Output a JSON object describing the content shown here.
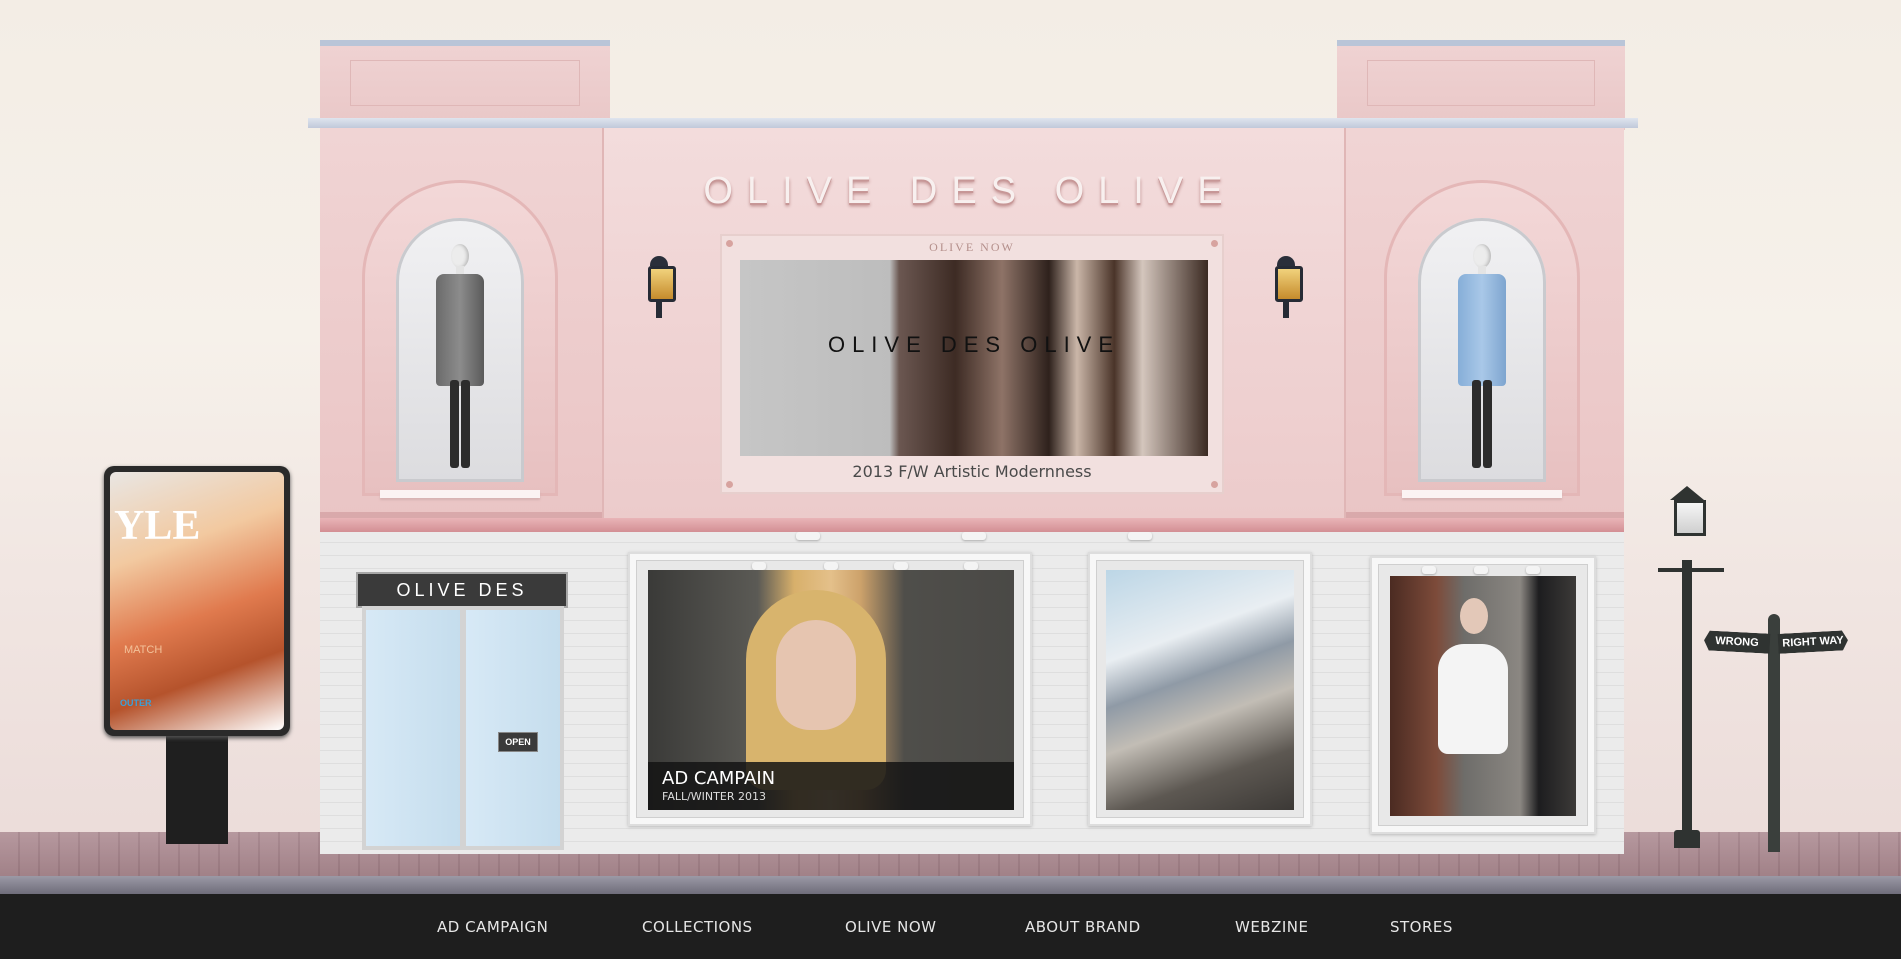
{
  "brand": {
    "store_title": "OLIVE DES OLIVE",
    "door_sign": "OLIVE DES OLIVE",
    "open_sign": "OPEN"
  },
  "billboard": {
    "label": "OLIVE NOW",
    "screen_text": "OLIVE DES OLIVE",
    "caption": "2013 F/W Artistic Modernness"
  },
  "ad_campaign": {
    "title": "AD CAMPAIN",
    "subtitle": "FALL/WINTER 2013"
  },
  "kiosk": {
    "logo": "YLE",
    "line1": "MATCH",
    "line2": "OUTER"
  },
  "street_sign": {
    "left": "WRONG WAY",
    "right": "RIGHT WAY"
  },
  "nav": {
    "items": [
      {
        "label": "AD CAMPAIGN"
      },
      {
        "label": "COLLECTIONS"
      },
      {
        "label": "OLIVE NOW"
      },
      {
        "label": "ABOUT BRAND"
      },
      {
        "label": "WEBZINE"
      },
      {
        "label": "STORES"
      }
    ]
  },
  "colors": {
    "facade_pink": "#eccbcb",
    "nav_background": "#1e1e1e",
    "nav_text": "#e6e6e6"
  }
}
